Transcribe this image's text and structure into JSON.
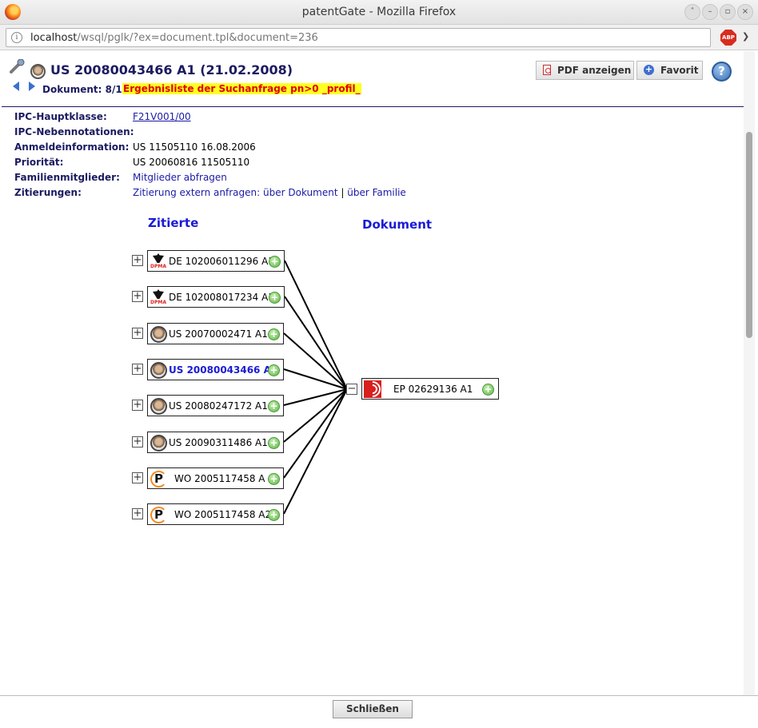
{
  "window": {
    "title": "patentGate - Mozilla Firefox"
  },
  "urlbar": {
    "host": "localhost",
    "path": "/wsql/pglk/?ex=document.tpl&document=236"
  },
  "header": {
    "doc_title": "US 20080043466 A1 (21.02.2008)",
    "nav_label": "Dokument: 8/14",
    "result_link": "Ergebnisliste der Suchanfrage pn>0 _profil_",
    "pdf_label": "PDF anzeigen",
    "fav_label": "Favorit",
    "help_glyph": "?"
  },
  "fields": [
    {
      "label": "IPC-Hauptklasse:",
      "value": "F21V001/00",
      "kind": "link-underline"
    },
    {
      "label": "IPC-Nebennotationen:",
      "value": "",
      "kind": "text"
    },
    {
      "label": "Anmeldeinformation:",
      "value": "US 11505110 16.08.2006",
      "kind": "text"
    },
    {
      "label": "Priorität:",
      "value": "US 20060816 11505110",
      "kind": "text"
    },
    {
      "label": "Familienmitglieder:",
      "value": "Mitglieder abfragen",
      "kind": "link"
    }
  ],
  "citations": {
    "label": "Zitierungen:",
    "prefix": "Zitierung extern anfragen:",
    "link1": "über Dokument",
    "sep": "|",
    "link2": "über Familie"
  },
  "graph": {
    "col_left": "Zitierte",
    "col_right": "Dokument",
    "cited": [
      {
        "label": "DE 102006011296 A1",
        "office": "de",
        "current": false
      },
      {
        "label": "DE 102008017234 A1",
        "office": "de",
        "current": false
      },
      {
        "label": "US 20070002471 A1",
        "office": "us",
        "current": false
      },
      {
        "label": "US 20080043466 A1",
        "office": "us",
        "current": true
      },
      {
        "label": "US 20080247172 A1",
        "office": "us",
        "current": false
      },
      {
        "label": "US 20090311486 A1",
        "office": "us",
        "current": false
      },
      {
        "label": "WO 2005117458 A",
        "office": "wo",
        "current": false
      },
      {
        "label": "WO 2005117458 A2",
        "office": "wo",
        "current": false
      }
    ],
    "target": {
      "label": "EP 02629136 A1",
      "office": "ep"
    },
    "expand_glyph": "+",
    "collapse_glyph": "−",
    "dpma_text": "DPMA",
    "wo_glyph": "P"
  },
  "footer": {
    "close_label": "Schließen"
  },
  "icons": [
    "firefox-logo-icon",
    "info-icon",
    "adblock-icon",
    "wrench-icon",
    "pdf-icon",
    "favorite-plus-icon",
    "help-icon",
    "add-icon",
    "expand-icon",
    "collapse-icon"
  ],
  "colors": {
    "heading": "#1b1b60",
    "link": "#1a1aa6",
    "graph_heading": "#1b1bd6",
    "highlight_bg": "#ffff22",
    "highlight_text": "#e00000",
    "edge": "#000000"
  }
}
